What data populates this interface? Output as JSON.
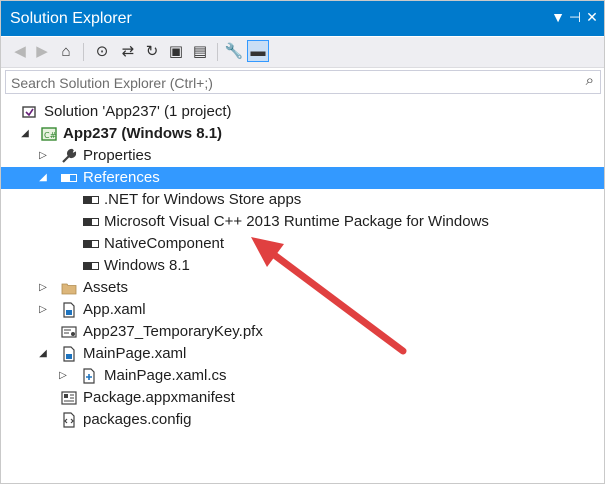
{
  "window": {
    "title": "Solution Explorer",
    "pin_glyph": "▼",
    "autohide_glyph": "⊣",
    "close_glyph": "✕"
  },
  "toolbar": {
    "buttons": [
      {
        "name": "back-icon",
        "glyph": "◀"
      },
      {
        "name": "forward-icon",
        "glyph": "▶"
      },
      {
        "name": "home-icon",
        "glyph": "⌂"
      },
      {
        "name": "pending-changes-filter-icon",
        "glyph": "⊙"
      },
      {
        "name": "sync-with-active-document-icon",
        "glyph": "⇄"
      },
      {
        "name": "refresh-icon",
        "glyph": "↻"
      },
      {
        "name": "collapse-all-icon",
        "glyph": "▣"
      },
      {
        "name": "show-all-files-icon",
        "glyph": "▤"
      },
      {
        "name": "properties-icon",
        "glyph": "🔧"
      },
      {
        "name": "preview-selected-items-icon",
        "glyph": "▬"
      }
    ]
  },
  "search": {
    "placeholder": "Search Solution Explorer (Ctrl+;)",
    "icon_glyph": "⌕"
  },
  "tree": {
    "solution": "Solution 'App237' (1 project)",
    "project": "App237 (Windows 8.1)",
    "properties": "Properties",
    "references": "References",
    "ref_items": [
      ".NET for Windows Store apps",
      "Microsoft Visual C++ 2013 Runtime Package for Windows",
      "NativeComponent",
      "Windows 8.1"
    ],
    "assets": "Assets",
    "app_xaml": "App.xaml",
    "temp_key": "App237_TemporaryKey.pfx",
    "mainpage": "MainPage.xaml",
    "mainpage_cs": "MainPage.xaml.cs",
    "manifest": "Package.appxmanifest",
    "packages_config": "packages.config"
  },
  "colors": {
    "titlebar": "#007acc",
    "selection": "#3399ff",
    "annotation_arrow": "#e04040"
  }
}
